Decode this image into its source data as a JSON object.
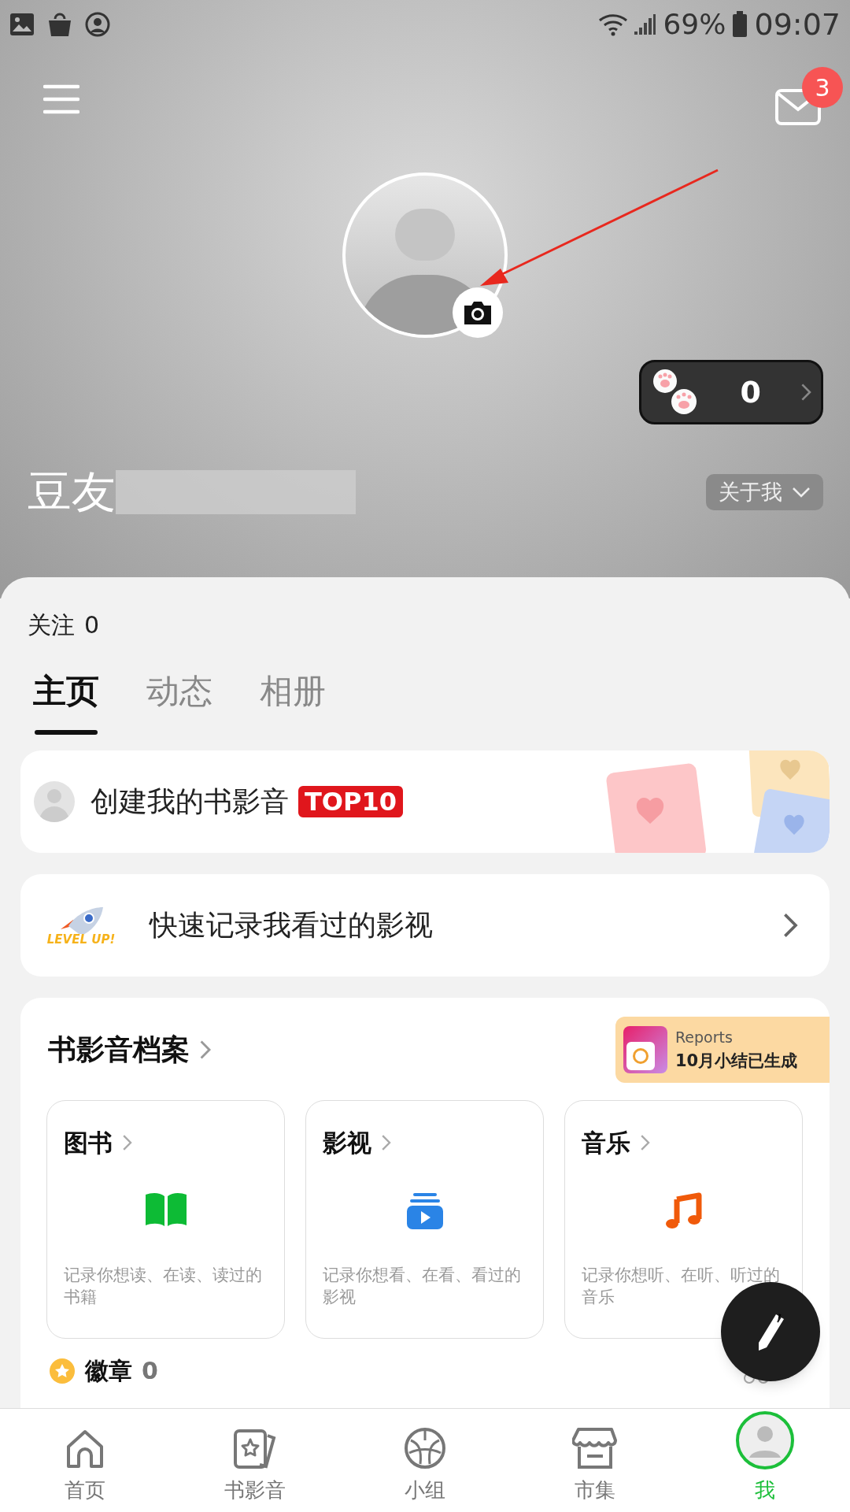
{
  "status_bar": {
    "battery": "69%",
    "time": "09:07"
  },
  "header": {
    "notification_count": "3",
    "paw_count": "0",
    "username": "豆友",
    "about_button": "关于我"
  },
  "follow": {
    "label": "关注",
    "count": "0"
  },
  "tabs": [
    {
      "label": "主页",
      "selected": true
    },
    {
      "label": "动态",
      "selected": false
    },
    {
      "label": "相册",
      "selected": false
    }
  ],
  "top10_card": {
    "title": "创建我的书影音",
    "badge": "TOP10"
  },
  "record_card": {
    "title": "快速记录我看过的影视",
    "logo": "LEVEL UP!"
  },
  "archive": {
    "title": "书影音档案",
    "report": {
      "label": "Reports",
      "text": "10月小结已生成"
    },
    "categories": [
      {
        "kind": "book",
        "title": "图书",
        "description": "记录你想读、在读、读过的书籍"
      },
      {
        "kind": "video",
        "title": "影视",
        "description": "记录你想看、在看、看过的影视"
      },
      {
        "kind": "music",
        "title": "音乐",
        "description": "记录你想听、在听、听过的音乐"
      }
    ]
  },
  "badges": {
    "title": "徽章",
    "count": "0"
  },
  "bottom_nav": [
    {
      "kind": "home",
      "label": "首页",
      "selected": false
    },
    {
      "kind": "cards",
      "label": "书影音",
      "selected": false
    },
    {
      "kind": "group",
      "label": "小组",
      "selected": false
    },
    {
      "kind": "market",
      "label": "市集",
      "selected": false
    },
    {
      "kind": "me",
      "label": "我",
      "selected": true
    }
  ]
}
